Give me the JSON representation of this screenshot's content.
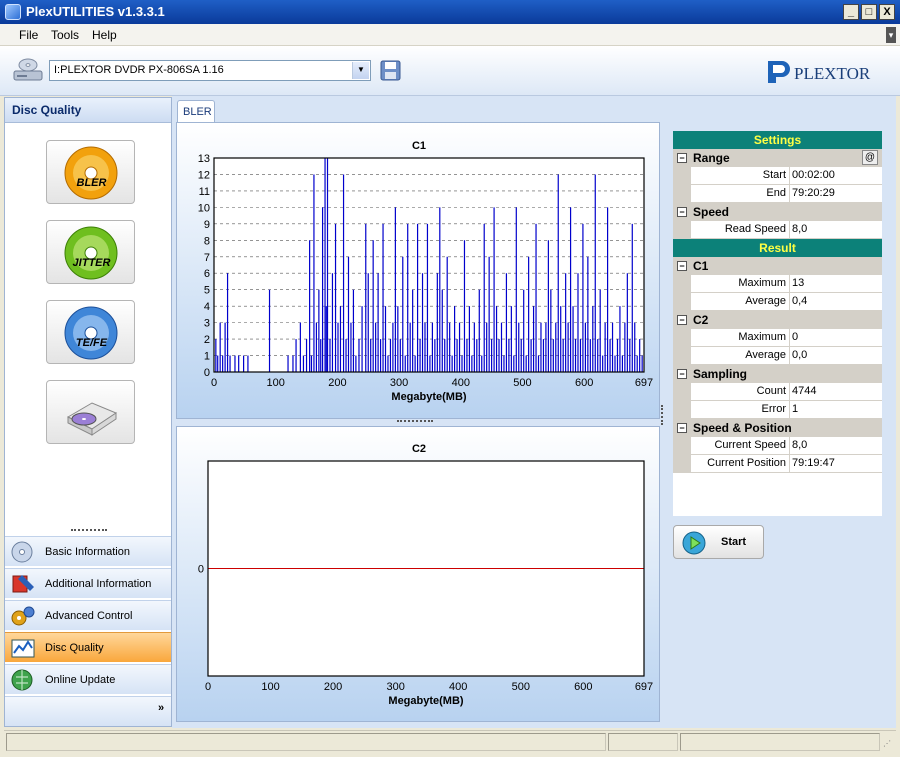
{
  "window": {
    "title": "PlexUTILITIES v1.3.3.1",
    "min": "_",
    "max": "□",
    "close": "X"
  },
  "menu": [
    "File",
    "Tools",
    "Help"
  ],
  "toolbar": {
    "drive": "I:PLEXTOR DVDR   PX-806SA  1.16",
    "logo_text": "PLEXTOR"
  },
  "left": {
    "header": "Disc Quality",
    "tools": [
      {
        "label": "BLER"
      },
      {
        "label": "JITTER"
      },
      {
        "label": "TE/FE"
      }
    ],
    "nav": [
      {
        "label": "Basic Information",
        "icon": "cd-info-icon"
      },
      {
        "label": "Additional Information",
        "icon": "tools-info-icon"
      },
      {
        "label": "Advanced Control",
        "icon": "gears-icon"
      },
      {
        "label": "Disc Quality",
        "icon": "chart-icon",
        "active": true
      },
      {
        "label": "Online Update",
        "icon": "globe-update-icon"
      }
    ],
    "more": "»"
  },
  "tab": "BLER",
  "chart_data": [
    {
      "type": "bar",
      "title": "C1",
      "xlabel": "Megabyte(MB)",
      "xlim": [
        0,
        697
      ],
      "ylim": [
        0,
        13
      ],
      "xticks": [
        0,
        100,
        200,
        300,
        400,
        500,
        600,
        697
      ],
      "yticks": [
        0,
        1,
        2,
        3,
        4,
        5,
        6,
        7,
        8,
        9,
        10,
        11,
        12,
        13
      ],
      "grid": true,
      "color": "#0000cc",
      "points": [
        [
          3,
          2
        ],
        [
          6,
          1
        ],
        [
          10,
          3
        ],
        [
          14,
          1
        ],
        [
          18,
          3
        ],
        [
          22,
          6
        ],
        [
          26,
          1
        ],
        [
          34,
          1
        ],
        [
          40,
          1
        ],
        [
          48,
          1
        ],
        [
          55,
          1
        ],
        [
          90,
          5
        ],
        [
          120,
          1
        ],
        [
          128,
          1
        ],
        [
          133,
          2
        ],
        [
          140,
          3
        ],
        [
          145,
          1
        ],
        [
          150,
          2
        ],
        [
          155,
          8
        ],
        [
          158,
          1
        ],
        [
          162,
          12
        ],
        [
          166,
          3
        ],
        [
          170,
          5
        ],
        [
          173,
          2
        ],
        [
          176,
          10
        ],
        [
          180,
          13
        ],
        [
          182,
          4
        ],
        [
          184,
          13
        ],
        [
          188,
          2
        ],
        [
          192,
          6
        ],
        [
          197,
          9
        ],
        [
          201,
          3
        ],
        [
          205,
          4
        ],
        [
          210,
          12
        ],
        [
          214,
          2
        ],
        [
          218,
          7
        ],
        [
          222,
          3
        ],
        [
          226,
          5
        ],
        [
          230,
          1
        ],
        [
          235,
          2
        ],
        [
          240,
          4
        ],
        [
          246,
          9
        ],
        [
          250,
          6
        ],
        [
          254,
          2
        ],
        [
          258,
          8
        ],
        [
          262,
          3
        ],
        [
          266,
          6
        ],
        [
          270,
          2
        ],
        [
          274,
          9
        ],
        [
          278,
          4
        ],
        [
          282,
          1
        ],
        [
          286,
          2
        ],
        [
          290,
          3
        ],
        [
          294,
          10
        ],
        [
          298,
          4
        ],
        [
          302,
          2
        ],
        [
          306,
          7
        ],
        [
          310,
          1
        ],
        [
          314,
          9
        ],
        [
          318,
          3
        ],
        [
          322,
          5
        ],
        [
          326,
          1
        ],
        [
          330,
          9
        ],
        [
          334,
          2
        ],
        [
          338,
          6
        ],
        [
          342,
          3
        ],
        [
          346,
          9
        ],
        [
          350,
          1
        ],
        [
          354,
          3
        ],
        [
          358,
          2
        ],
        [
          362,
          6
        ],
        [
          366,
          10
        ],
        [
          370,
          5
        ],
        [
          374,
          2
        ],
        [
          378,
          7
        ],
        [
          382,
          3
        ],
        [
          386,
          1
        ],
        [
          390,
          4
        ],
        [
          394,
          2
        ],
        [
          398,
          3
        ],
        [
          402,
          1
        ],
        [
          406,
          8
        ],
        [
          410,
          2
        ],
        [
          414,
          4
        ],
        [
          418,
          1
        ],
        [
          422,
          3
        ],
        [
          426,
          2
        ],
        [
          430,
          5
        ],
        [
          434,
          1
        ],
        [
          438,
          9
        ],
        [
          442,
          3
        ],
        [
          446,
          7
        ],
        [
          450,
          2
        ],
        [
          454,
          10
        ],
        [
          458,
          4
        ],
        [
          462,
          2
        ],
        [
          466,
          3
        ],
        [
          470,
          1
        ],
        [
          474,
          6
        ],
        [
          478,
          2
        ],
        [
          482,
          4
        ],
        [
          486,
          1
        ],
        [
          490,
          10
        ],
        [
          494,
          3
        ],
        [
          498,
          2
        ],
        [
          502,
          5
        ],
        [
          506,
          1
        ],
        [
          510,
          7
        ],
        [
          514,
          2
        ],
        [
          518,
          4
        ],
        [
          522,
          9
        ],
        [
          526,
          1
        ],
        [
          530,
          3
        ],
        [
          534,
          2
        ],
        [
          538,
          3
        ],
        [
          542,
          8
        ],
        [
          546,
          5
        ],
        [
          550,
          2
        ],
        [
          554,
          3
        ],
        [
          558,
          12
        ],
        [
          562,
          4
        ],
        [
          566,
          2
        ],
        [
          570,
          6
        ],
        [
          574,
          3
        ],
        [
          578,
          10
        ],
        [
          582,
          4
        ],
        [
          586,
          2
        ],
        [
          590,
          6
        ],
        [
          594,
          2
        ],
        [
          598,
          9
        ],
        [
          602,
          3
        ],
        [
          606,
          7
        ],
        [
          610,
          2
        ],
        [
          614,
          4
        ],
        [
          618,
          12
        ],
        [
          622,
          2
        ],
        [
          626,
          5
        ],
        [
          630,
          1
        ],
        [
          634,
          3
        ],
        [
          638,
          10
        ],
        [
          642,
          2
        ],
        [
          646,
          3
        ],
        [
          650,
          1
        ],
        [
          654,
          2
        ],
        [
          658,
          4
        ],
        [
          662,
          1
        ],
        [
          666,
          3
        ],
        [
          670,
          6
        ],
        [
          674,
          2
        ],
        [
          678,
          9
        ],
        [
          682,
          3
        ],
        [
          686,
          1
        ],
        [
          690,
          2
        ],
        [
          694,
          1
        ]
      ]
    },
    {
      "type": "line",
      "title": "C2",
      "xlabel": "Megabyte(MB)",
      "xlim": [
        0,
        697
      ],
      "ylim": [
        -1,
        1
      ],
      "xticks": [
        0,
        100,
        200,
        300,
        400,
        500,
        600,
        697
      ],
      "yticks": [
        0
      ],
      "grid": false,
      "color": "#cc0000",
      "x": [
        0,
        697
      ],
      "y": [
        0,
        0
      ]
    }
  ],
  "settings": {
    "header": "Settings",
    "range": {
      "label": "Range",
      "at": "@",
      "start_label": "Start",
      "start": "00:02:00",
      "end_label": "End",
      "end": "79:20:29"
    },
    "speed": {
      "label": "Speed",
      "read_label": "Read Speed",
      "read": "8,0"
    }
  },
  "result": {
    "header": "Result",
    "c1": {
      "label": "C1",
      "max_label": "Maximum",
      "max": "13",
      "avg_label": "Average",
      "avg": "0,4"
    },
    "c2": {
      "label": "C2",
      "max_label": "Maximum",
      "max": "0",
      "avg_label": "Average",
      "avg": "0,0"
    },
    "sampling": {
      "label": "Sampling",
      "count_label": "Count",
      "count": "4744",
      "error_label": "Error",
      "error": "1"
    },
    "speedpos": {
      "label": "Speed & Position",
      "speed_label": "Current Speed",
      "speed": "8,0",
      "pos_label": "Current Position",
      "pos": "79:19:47"
    }
  },
  "start_button": "Start"
}
